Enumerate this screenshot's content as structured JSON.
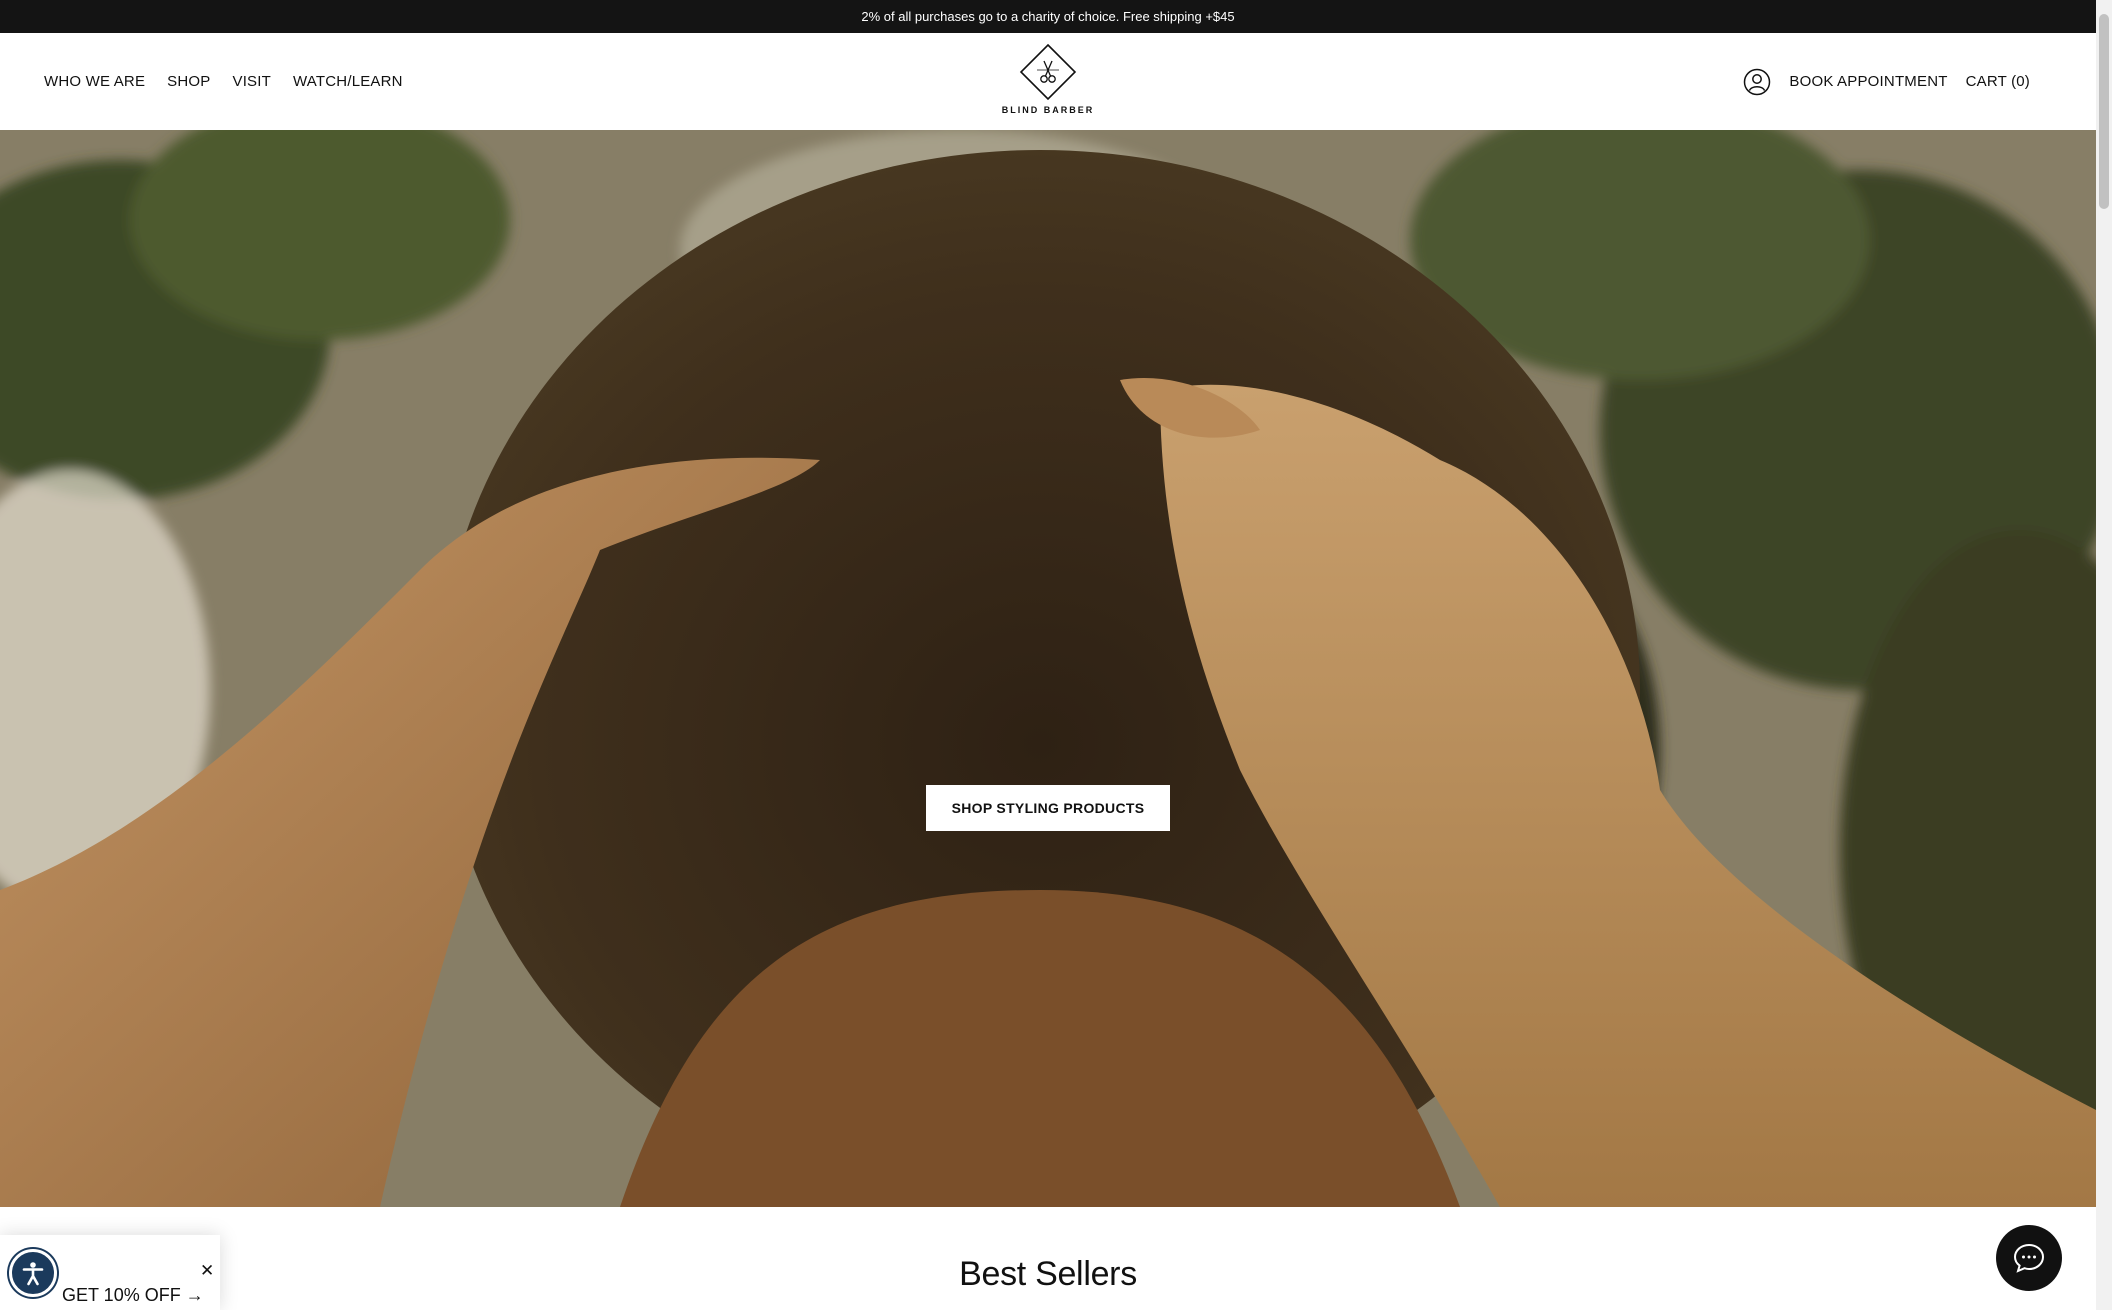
{
  "announcement": "2% of all purchases go to a charity of choice. Free shipping +$45",
  "nav": {
    "left": [
      {
        "label": "WHO WE ARE"
      },
      {
        "label": "SHOP"
      },
      {
        "label": "VISIT"
      },
      {
        "label": "WATCH/LEARN"
      }
    ],
    "logo_text": "BLIND BARBER",
    "account_icon": "account-icon",
    "book_label": "BOOK APPOINTMENT",
    "cart_label": "CART (0)"
  },
  "hero": {
    "cta_label": "SHOP STYLING PRODUCTS"
  },
  "best_sellers": {
    "title": "Best Sellers"
  },
  "promo": {
    "label": "GET 10% OFF →",
    "close": "✕"
  },
  "widgets": {
    "accessibility_icon": "accessibility-icon",
    "chat_icon": "chat-icon"
  },
  "colors": {
    "announce_bg": "#141414",
    "text": "#111111",
    "a11y_bg": "#1b3a5c"
  }
}
